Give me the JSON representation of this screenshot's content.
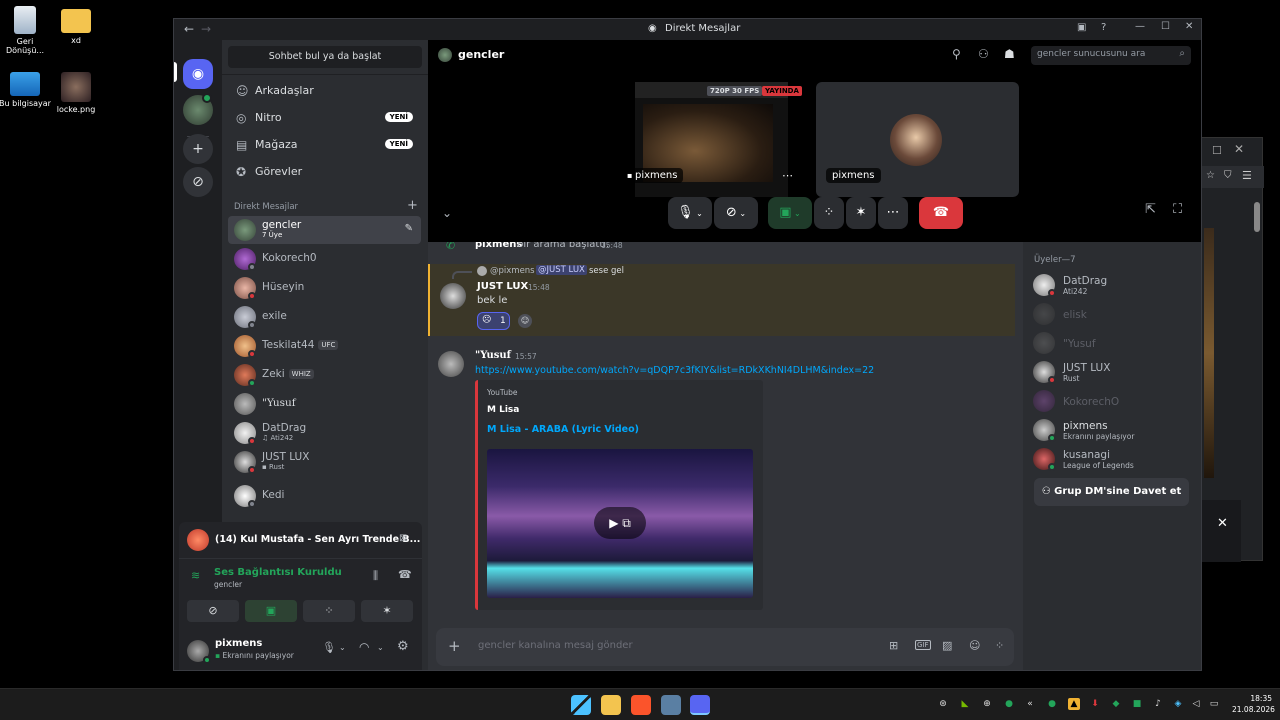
{
  "desktop": {
    "icons": [
      {
        "label": "Geri Dönüşü..."
      },
      {
        "label": "xd"
      },
      {
        "label": "Bu bilgisayar"
      },
      {
        "label": "locke.png"
      }
    ]
  },
  "window": {
    "title": "Direkt Mesajlar"
  },
  "sidebar": {
    "search_placeholder": "Sohbet bul ya da başlat",
    "nav": [
      {
        "label": "Arkadaşlar",
        "icon": "friends-icon"
      },
      {
        "label": "Nitro",
        "icon": "nitro-icon",
        "badge": "YENİ"
      },
      {
        "label": "Mağaza",
        "icon": "shop-icon",
        "badge": "YENİ"
      },
      {
        "label": "Görevler",
        "icon": "quests-icon"
      }
    ],
    "dm_header": "Direkt Mesajlar",
    "dms": [
      {
        "name": "gencler",
        "sub": "7 Üye"
      },
      {
        "name": "Kokorech0"
      },
      {
        "name": "Hüseyin"
      },
      {
        "name": "exile"
      },
      {
        "name": "Teskilat44",
        "tag": "UFC"
      },
      {
        "name": "Zeki",
        "tag": "WHIZ"
      },
      {
        "name": "\"Yusuf"
      },
      {
        "name": "DatDrag",
        "sub": "Ati242"
      },
      {
        "name": "JUST LUX",
        "sub": "Rust"
      },
      {
        "name": "Kedi"
      }
    ]
  },
  "voice_panel": {
    "now_playing": "(14) Kul Mustafa - Sen Ayrı Trende B...",
    "connection": "Ses Bağlantısı Kuruldu",
    "channel": "gencler",
    "user": "pixmens",
    "user_status": "Ekranını paylaşıyor"
  },
  "header": {
    "channel": "gencler",
    "search_placeholder": "gencler sunucusunu ara"
  },
  "call": {
    "stream_badge": "720P 30 FPS",
    "live_badge": "YAYINDA",
    "tile1_name": "pixmens",
    "tile2_name": "pixmens"
  },
  "chat": {
    "system_user": "pixmens",
    "system_text": "bir arama başlattı.",
    "system_time": "15:48",
    "reply_user": "@pixmens",
    "reply_mention": "@JUST LUX",
    "reply_text": "sese gel",
    "msg1_user": "JUST LUX",
    "msg1_time": "15:48",
    "msg1_text": "bek le",
    "msg1_reaction_count": "1",
    "msg2_user": "\"Yusuf",
    "msg2_time": "15:57",
    "msg2_link": "https://www.youtube.com/watch?v=qDQP7c3fKIY&list=RDkXKhNI4DLHM&index=22",
    "embed_provider": "YouTube",
    "embed_author": "M Lisa",
    "embed_title": "M Lisa - ARABA (Lyric Video)",
    "input_placeholder": "gencler kanalına mesaj gönder"
  },
  "members": {
    "header": "Üyeler—7",
    "list": [
      {
        "name": "DatDrag",
        "sub": "Ati242",
        "color": "#b5bac1"
      },
      {
        "name": "elisk",
        "sub": "",
        "color": "#5c5e66"
      },
      {
        "name": "\"Yusuf",
        "sub": "",
        "color": "#5c5e66"
      },
      {
        "name": "JUST LUX",
        "sub": "Rust",
        "color": "#b5bac1"
      },
      {
        "name": "KokorechO",
        "sub": "",
        "color": "#5c5e66"
      },
      {
        "name": "pixmens",
        "sub": "Ekranını paylaşıyor",
        "color": "#dbdee1"
      },
      {
        "name": "kusanagi",
        "sub": "League of Legends",
        "color": "#b5bac1"
      }
    ],
    "invite_button": "Grup DM'sine Davet et"
  },
  "taskbar": {
    "time": "18:35",
    "date": "21.08.2026"
  },
  "colors": {
    "accent": "#5865f2",
    "green": "#23a55a",
    "red": "#da373c",
    "link": "#00a8fc",
    "mention_bg": "#3c4270"
  }
}
